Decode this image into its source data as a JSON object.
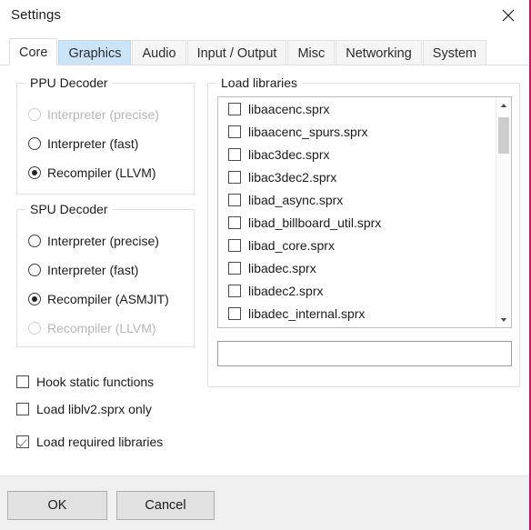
{
  "window": {
    "title": "Settings",
    "close_icon": "close-icon"
  },
  "tabs": [
    {
      "label": "Core",
      "state": "active"
    },
    {
      "label": "Graphics",
      "state": "hovered"
    },
    {
      "label": "Audio",
      "state": "normal"
    },
    {
      "label": "Input / Output",
      "state": "normal"
    },
    {
      "label": "Misc",
      "state": "normal"
    },
    {
      "label": "Networking",
      "state": "normal"
    },
    {
      "label": "System",
      "state": "normal"
    }
  ],
  "ppu_decoder": {
    "title": "PPU Decoder",
    "options": [
      {
        "label": "Interpreter (precise)",
        "checked": false,
        "disabled": true
      },
      {
        "label": "Interpreter (fast)",
        "checked": false,
        "disabled": false
      },
      {
        "label": "Recompiler (LLVM)",
        "checked": true,
        "disabled": false
      }
    ]
  },
  "spu_decoder": {
    "title": "SPU Decoder",
    "options": [
      {
        "label": "Interpreter (precise)",
        "checked": false,
        "disabled": false
      },
      {
        "label": "Interpreter (fast)",
        "checked": false,
        "disabled": false
      },
      {
        "label": "Recompiler (ASMJIT)",
        "checked": true,
        "disabled": false
      },
      {
        "label": "Recompiler (LLVM)",
        "checked": false,
        "disabled": true
      }
    ]
  },
  "load_libraries": {
    "title": "Load libraries",
    "items": [
      {
        "label": "libaacenc.sprx",
        "checked": false
      },
      {
        "label": "libaacenc_spurs.sprx",
        "checked": false
      },
      {
        "label": "libac3dec.sprx",
        "checked": false
      },
      {
        "label": "libac3dec2.sprx",
        "checked": false
      },
      {
        "label": "libad_async.sprx",
        "checked": false
      },
      {
        "label": "libad_billboard_util.sprx",
        "checked": false
      },
      {
        "label": "libad_core.sprx",
        "checked": false
      },
      {
        "label": "libadec.sprx",
        "checked": false
      },
      {
        "label": "libadec2.sprx",
        "checked": false
      },
      {
        "label": "libadec_internal.sprx",
        "checked": false
      }
    ],
    "filter": {
      "value": "",
      "placeholder": ""
    },
    "scrollbar": {
      "up_icon": "scroll-up-arrow-icon",
      "down_icon": "scroll-down-arrow-icon"
    }
  },
  "options": [
    {
      "label": "Hook static functions",
      "checked": false
    },
    {
      "label": "Load liblv2.sprx only",
      "checked": false
    },
    {
      "label": "Load required libraries",
      "checked": true
    }
  ],
  "footer": {
    "ok_label": "OK",
    "cancel_label": "Cancel"
  },
  "colors": {
    "accent_tab_hover": "#cce4f7",
    "window_bg": "#ffffff",
    "footer_bg": "#f0f0f0",
    "button_bg": "#e1e1e1"
  }
}
